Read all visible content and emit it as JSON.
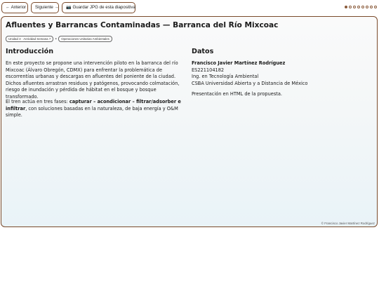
{
  "nav": {
    "prev_label": "← Anterior",
    "next_label": "Siguiente →",
    "save_label": "Guardar JPG de esta diapositiva",
    "save_icon": "camera-icon",
    "dots_total": 8,
    "dots_active_index": 0,
    "dot_color": "#8a5a3a"
  },
  "slide": {
    "title": "Afluentes y Barrancas Contaminadas — Barranca del Río Mixcoac",
    "tags": [
      "Unidad 3 · Actividad Semana 7",
      "Operaciones Unitarias Ambientales"
    ],
    "tag_separator": "•",
    "intro": {
      "heading": "Introducción",
      "p1": "En este proyecto se propone una intervención piloto en la barranca del río Mixcoac (Álvaro Obregón, CDMX) para enfrentar la problemática de escorrentías urbanas y descargas en afluentes del poniente de la ciudad. Dichos afluentes arrastran residuos y patógenos, provocando colmatación, riesgo de inundación y pérdida de hábitat en el bosque y bosque transformado.",
      "p2_prefix": "El tren actúa en tres fases: ",
      "p2_bold": "capturar – acondicionar – filtrar/adsorber e infiltrar",
      "p2_suffix": ", con soluciones basadas en la naturaleza, de baja energía y O&M simple."
    },
    "data": {
      "heading": "Datos",
      "name": "Francisco Javier Martínez Rodríguez",
      "id": "ES221104182",
      "program": "Ing. en Tecnología Ambiental",
      "school": "CSBA Universidad Abierta y a Distancia de México",
      "note": "Presentación en HTML de la propuesta."
    },
    "footer": "© Francisco Javier Martínez Rodríguez"
  },
  "colors": {
    "accent_brown": "#7a4a2a",
    "slide_gradient_bottom": "#e9f3f8"
  }
}
